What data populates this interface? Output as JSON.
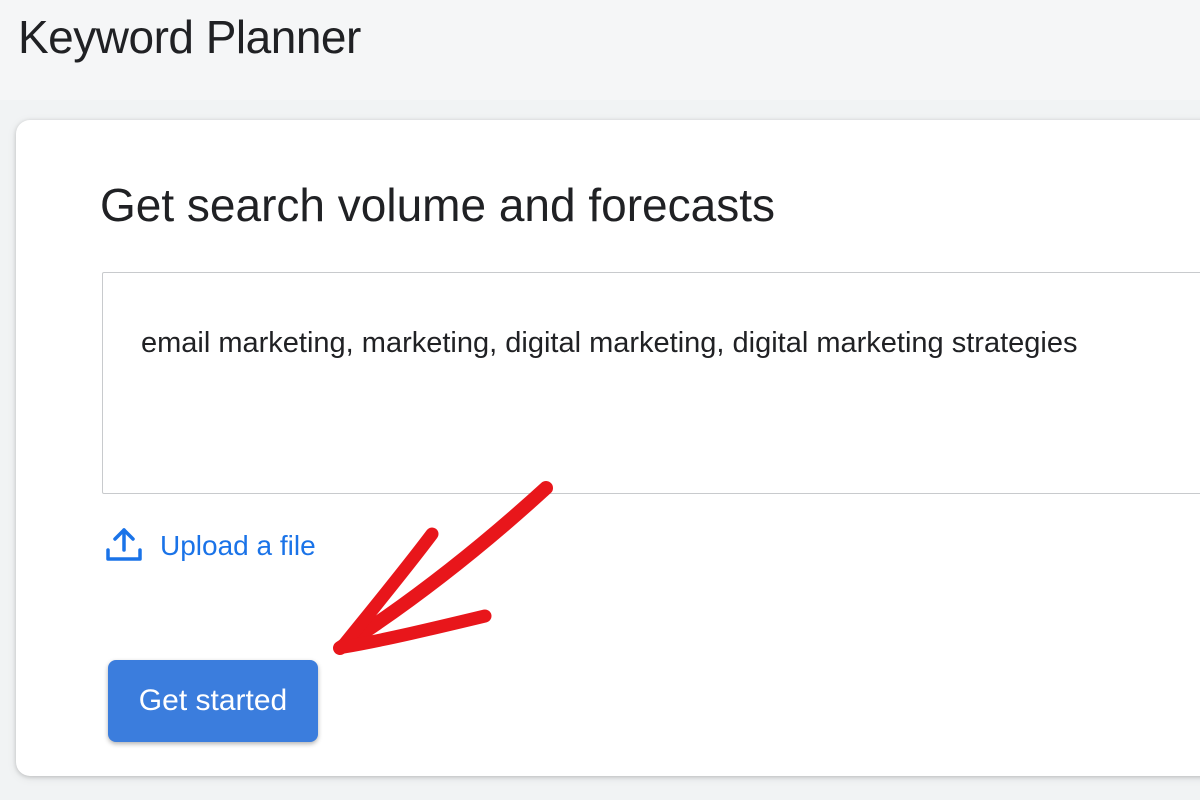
{
  "header": {
    "title": "Keyword Planner"
  },
  "card": {
    "title": "Get search volume and forecasts",
    "keywords_input": {
      "value": "email marketing, marketing, digital marketing, digital marketing strategies"
    },
    "upload": {
      "label": "Upload a file",
      "icon": "upload-icon"
    },
    "primary_button": {
      "label": "Get started"
    }
  },
  "colors": {
    "accent": "#1a73e8",
    "button": "#3b7ddd",
    "annotation": "#e8161b"
  }
}
